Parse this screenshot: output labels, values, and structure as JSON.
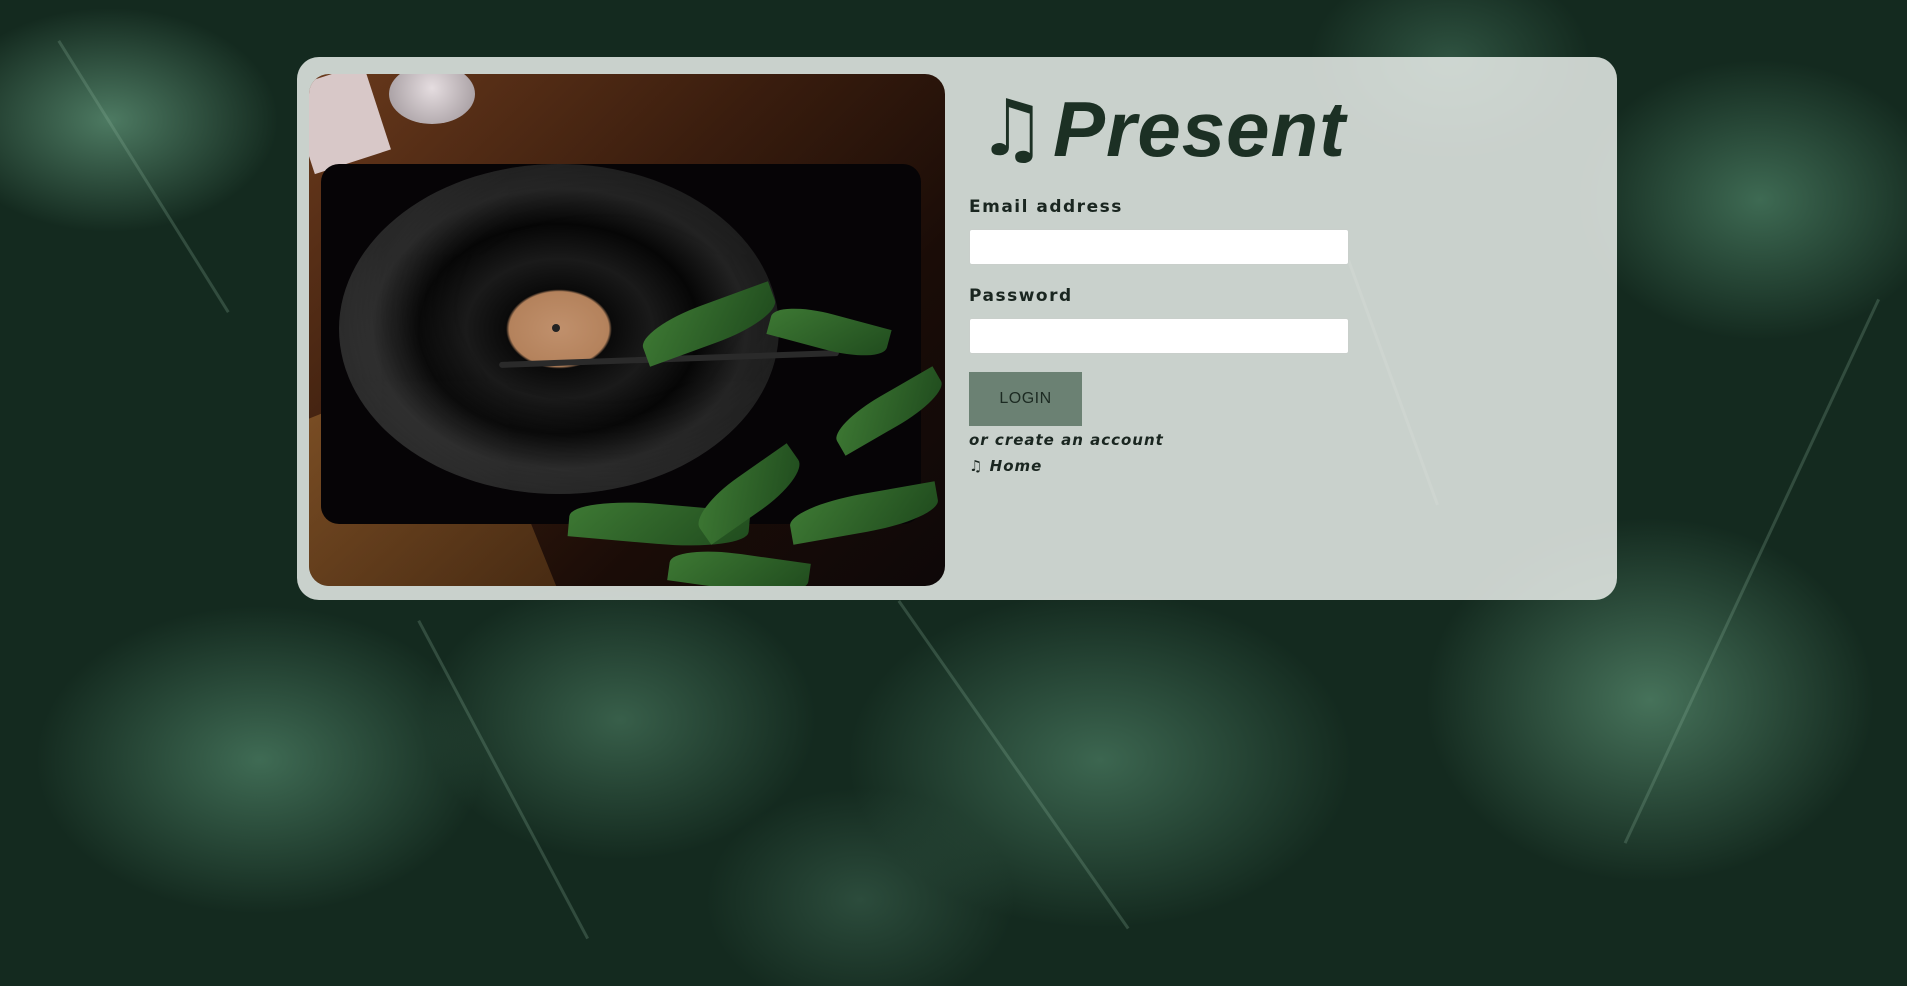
{
  "brand": {
    "icon": "♫",
    "name": "Present"
  },
  "form": {
    "email_label": "Email address",
    "email_value": "",
    "email_placeholder": "",
    "password_label": "Password",
    "password_value": "",
    "password_placeholder": "",
    "login_label": "LOGIN",
    "create_account_link": "or create an account",
    "home_link": "♫ Home"
  },
  "image": {
    "subject": "turntable-with-vinyl-record"
  },
  "background": {
    "subject": "monstera-leaves"
  },
  "colors": {
    "brand_text": "#1c3024",
    "card_bg": "#e8ece9",
    "button_bg": "#6b8173",
    "page_bg": "#142a1f"
  }
}
